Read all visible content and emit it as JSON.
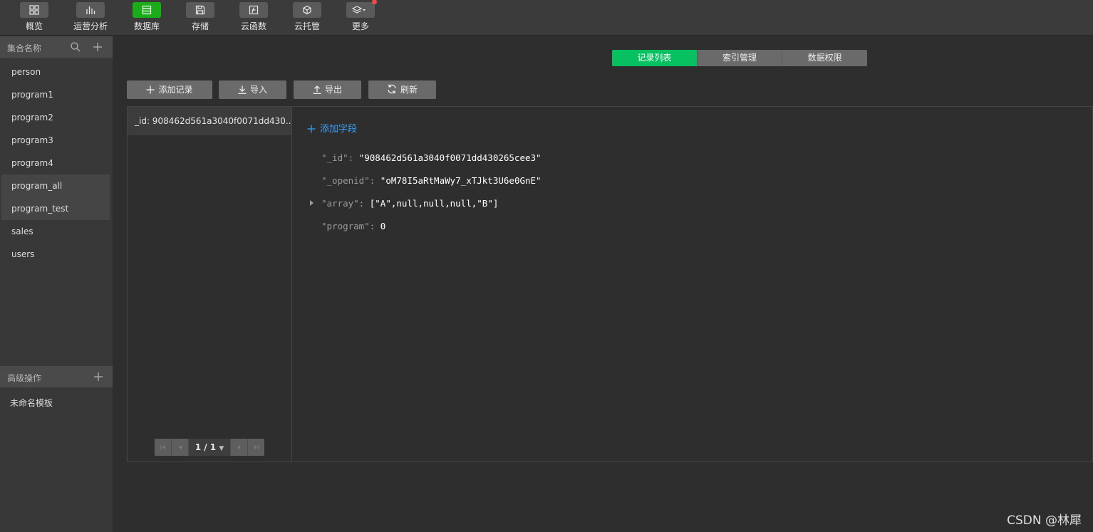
{
  "toolbar": {
    "items": [
      {
        "label": "概览",
        "icon": "grid-icon"
      },
      {
        "label": "运营分析",
        "icon": "bar-chart-icon"
      },
      {
        "label": "数据库",
        "icon": "database-icon",
        "active": true
      },
      {
        "label": "存储",
        "icon": "save-icon"
      },
      {
        "label": "云函数",
        "icon": "function-icon"
      },
      {
        "label": "云托管",
        "icon": "cube-icon"
      },
      {
        "label": "更多",
        "icon": "layers-icon",
        "badge": "red-dot"
      }
    ]
  },
  "sidebar": {
    "collections_title": "集合名称",
    "collections": [
      "person",
      "program1",
      "program2",
      "program3",
      "program4",
      "program_all",
      "program_test",
      "sales",
      "users"
    ],
    "selected": "program_all",
    "advanced_title": "高级操作",
    "template_item": "未命名模板"
  },
  "tabs": {
    "items": [
      "记录列表",
      "索引管理",
      "数据权限"
    ],
    "active": "记录列表"
  },
  "actions": {
    "add_record": "添加记录",
    "import": "导入",
    "export": "导出",
    "refresh": "刷新"
  },
  "records": {
    "items": [
      "_id: 908462d561a3040f0071dd430..."
    ],
    "pager": "1 / 1"
  },
  "detail": {
    "add_field": "添加字段",
    "fields": [
      {
        "key": "\"_id\":",
        "value": "\"908462d561a3040f0071dd430265cee3\""
      },
      {
        "key": "\"_openid\":",
        "value": "\"oM78I5aRtMaWy7_xTJkt3U6e0GnE\""
      },
      {
        "key": "\"array\":",
        "value": "[\"A\",null,null,null,\"B\"]",
        "expandable": true
      },
      {
        "key": "\"program\":",
        "value": "0"
      }
    ]
  },
  "watermark": "CSDN @林犀",
  "colors": {
    "accent_green": "#07c160",
    "link_blue": "#3a9ff4",
    "badge_red": "#f04a4a"
  }
}
